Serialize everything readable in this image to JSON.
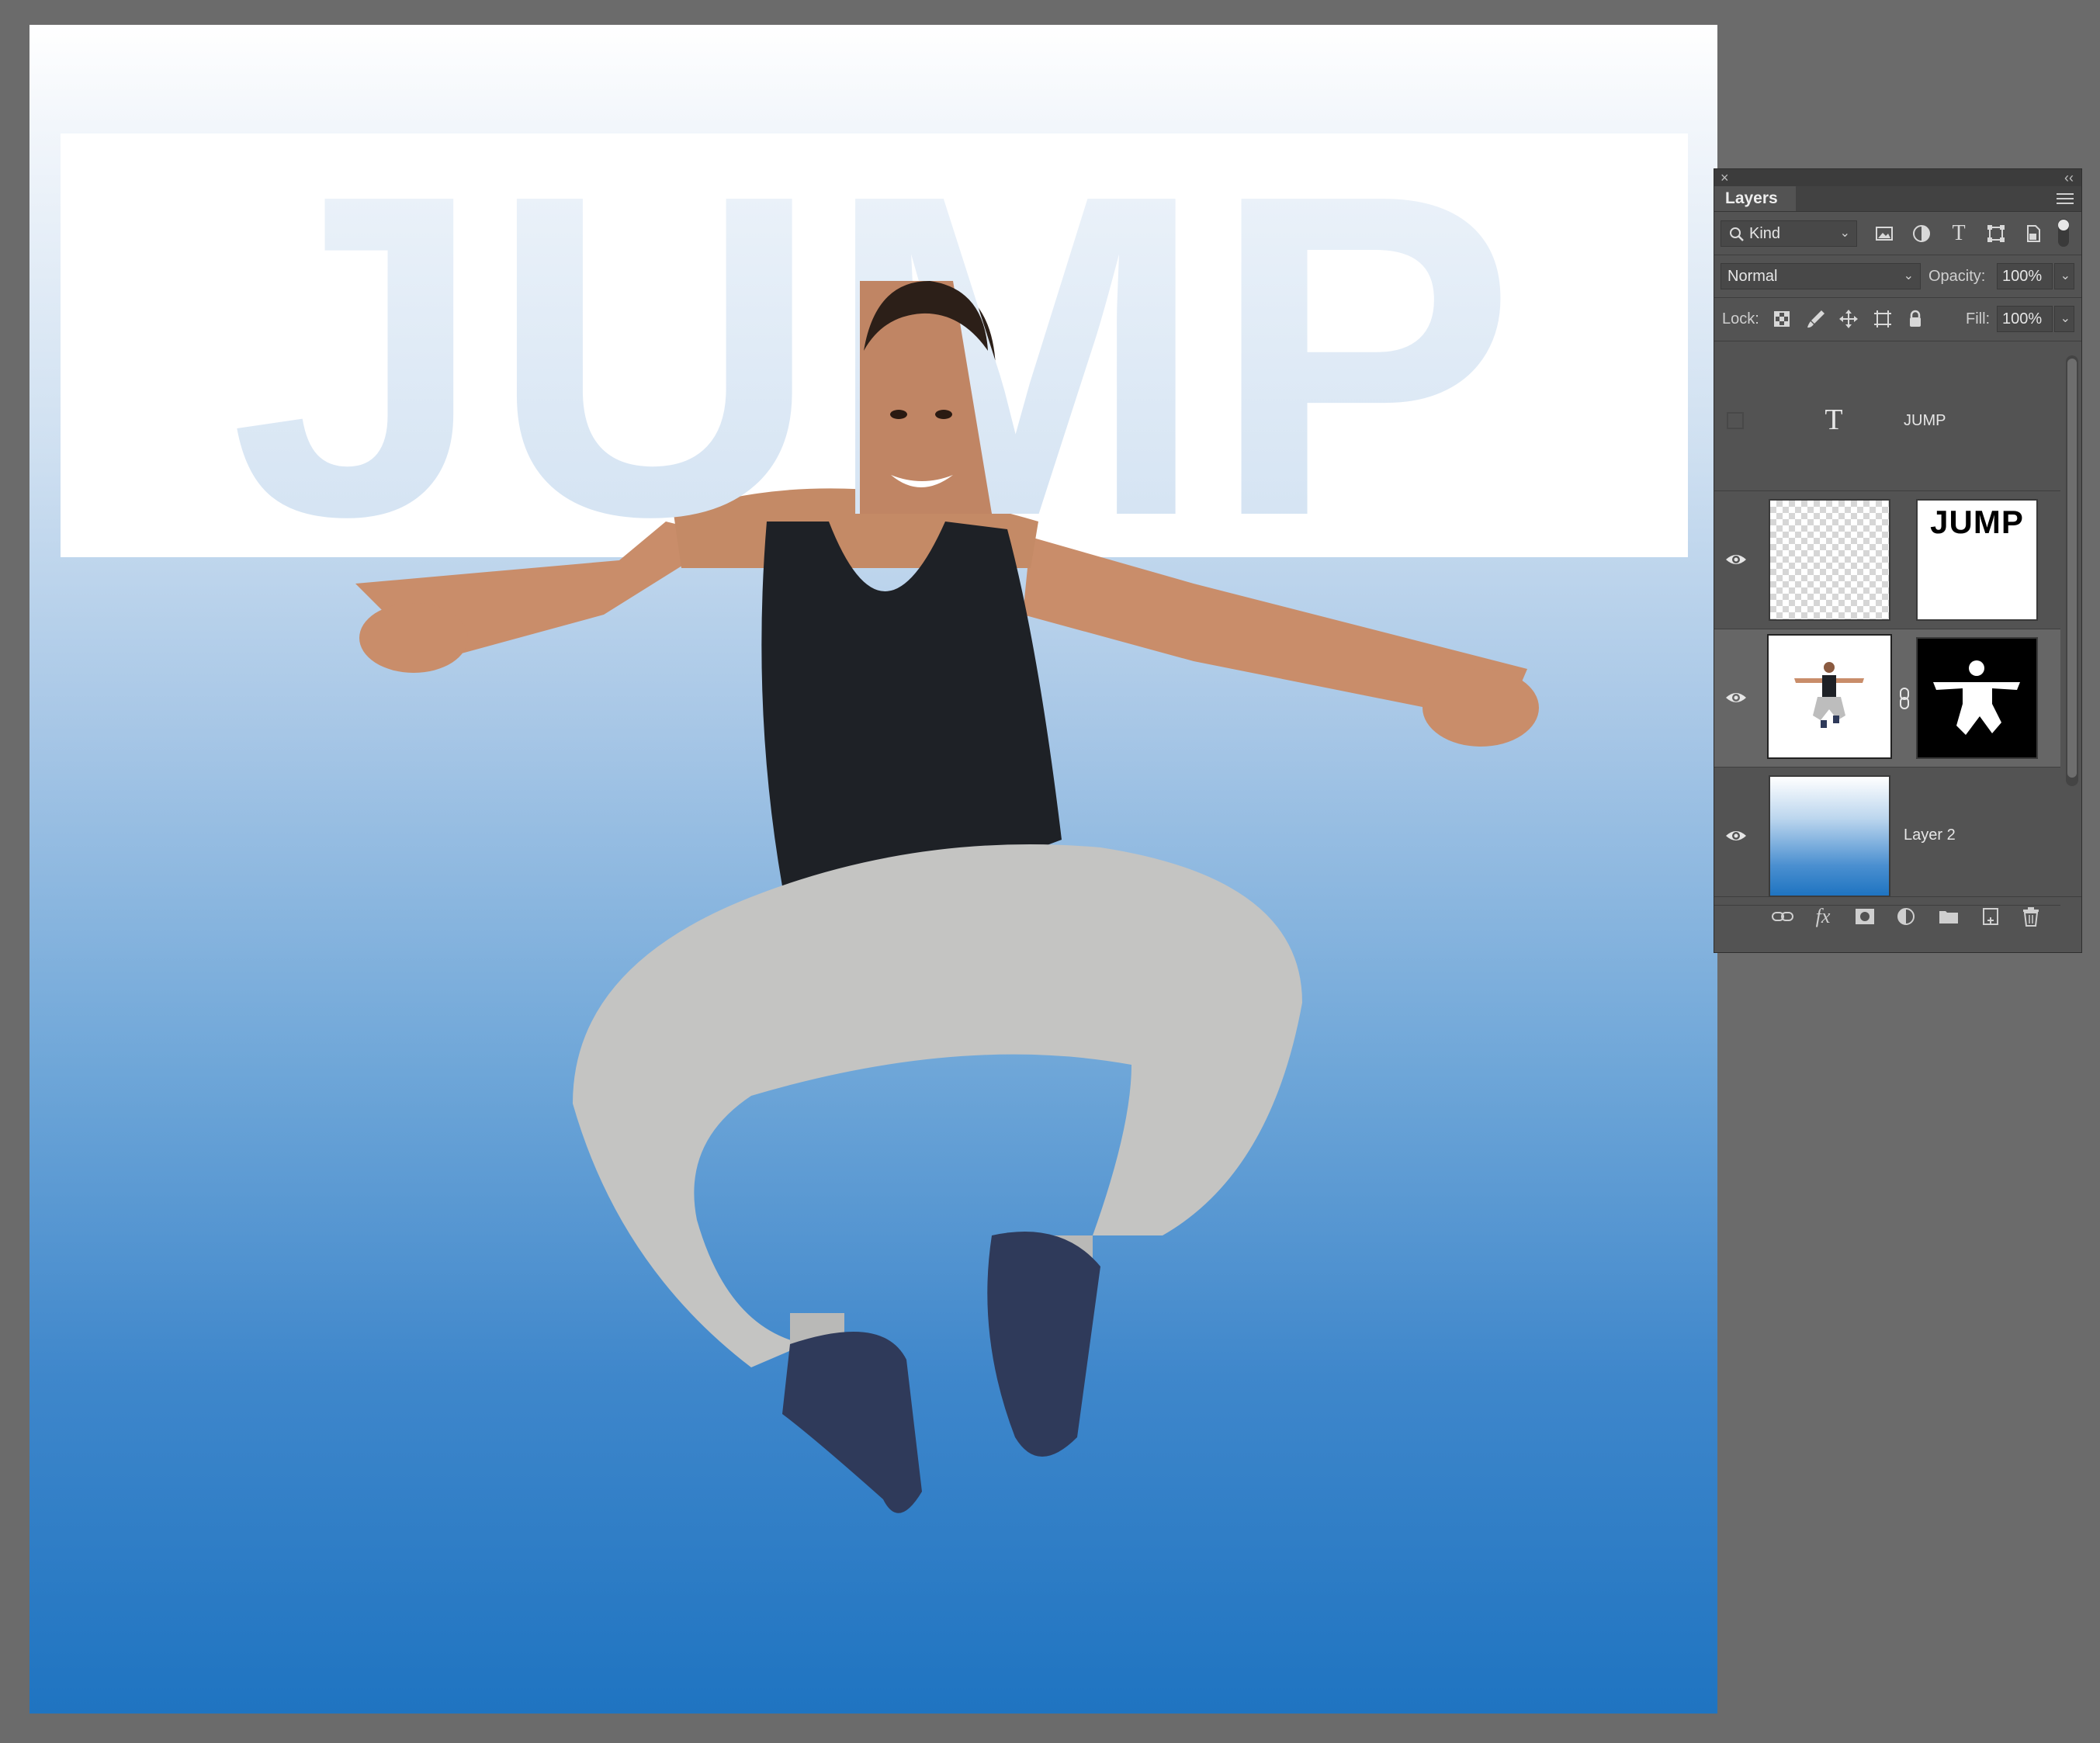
{
  "canvas": {
    "headline": "JUMP",
    "gradient_top": "#ffffff",
    "gradient_bottom": "#1f74c1"
  },
  "panel": {
    "close_glyph": "×",
    "collapse_glyph": "‹‹",
    "tab_label": "Layers",
    "filter": {
      "label": "Kind",
      "icons": [
        "pixel-filter-icon",
        "adjustment-filter-icon",
        "type-filter-icon",
        "shape-filter-icon",
        "smartobject-filter-icon",
        "filter-toggle-icon"
      ]
    },
    "blend_mode": "Normal",
    "opacity_label": "Opacity:",
    "opacity_value": "100%",
    "lock_label": "Lock:",
    "fill_label": "Fill:",
    "fill_value": "100%",
    "layers": [
      {
        "name": "JUMP",
        "kind": "text",
        "visible": false,
        "type_glyph": "T"
      },
      {
        "name": "",
        "kind": "masked-blank",
        "visible": true,
        "mask_text": "JUMP"
      },
      {
        "name": "",
        "kind": "photo-masked",
        "visible": true,
        "selected": true
      },
      {
        "name": "Layer 2",
        "kind": "gradient",
        "visible": true
      }
    ],
    "bottom_icons": [
      "link-layers-icon",
      "fx-icon",
      "add-mask-icon",
      "adjustment-layer-icon",
      "new-group-icon",
      "new-layer-icon",
      "trash-icon"
    ],
    "fx_label": "fx"
  }
}
